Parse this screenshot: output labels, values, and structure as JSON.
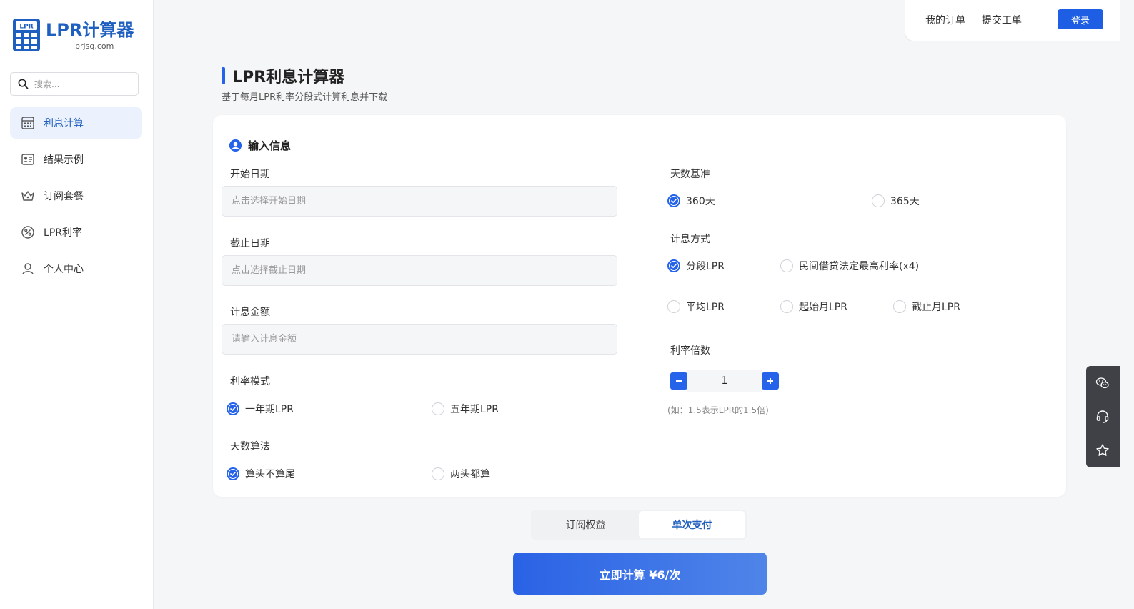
{
  "brand": {
    "logo_badge": "LPR",
    "title": "LPR计算器",
    "domain": "lprjsq.com",
    "accent": "#1f5fbf",
    "primary": "#2563eb"
  },
  "sidebar": {
    "search_placeholder": "搜索...",
    "items": [
      {
        "label": "利息计算",
        "icon": "calculator-icon",
        "active": true
      },
      {
        "label": "结果示例",
        "icon": "profile-card-icon",
        "active": false
      },
      {
        "label": "订阅套餐",
        "icon": "crown-icon",
        "active": false
      },
      {
        "label": "LPR利率",
        "icon": "percent-icon",
        "active": false
      },
      {
        "label": "个人中心",
        "icon": "user-icon",
        "active": false
      }
    ]
  },
  "topbar": {
    "orders": "我的订单",
    "ticket": "提交工单",
    "login": "登录"
  },
  "header": {
    "title": "LPR利息计算器",
    "subtitle": "基于每月LPR利率分段式计算利息并下载"
  },
  "form": {
    "section_title": "输入信息",
    "start_date": {
      "label": "开始日期",
      "placeholder": "点击选择开始日期"
    },
    "end_date": {
      "label": "截止日期",
      "placeholder": "点击选择截止日期"
    },
    "amount": {
      "label": "计息金额",
      "placeholder": "请输入计息金额"
    },
    "rate_mode": {
      "label": "利率模式",
      "options": [
        "一年期LPR",
        "五年期LPR"
      ],
      "selected": "一年期LPR"
    },
    "day_calc": {
      "label": "天数算法",
      "options": [
        "算头不算尾",
        "两头都算"
      ],
      "selected": "算头不算尾"
    },
    "day_base": {
      "label": "天数基准",
      "options": [
        "360天",
        "365天"
      ],
      "selected": "360天"
    },
    "method": {
      "label": "计息方式",
      "options": [
        "分段LPR",
        "民间借贷法定最高利率(x4)",
        "平均LPR",
        "起始月LPR",
        "截止月LPR"
      ],
      "selected": "分段LPR"
    },
    "multiplier": {
      "label": "利率倍数",
      "value": "1",
      "hint": "(如：1.5表示LPR的1.5倍)"
    }
  },
  "tabs": {
    "subscription": "订阅权益",
    "single": "单次支付",
    "active": "单次支付"
  },
  "cta": {
    "label": "立即计算 ¥6/次"
  },
  "float_icons": [
    "wechat-icon",
    "headset-icon",
    "star-icon"
  ]
}
